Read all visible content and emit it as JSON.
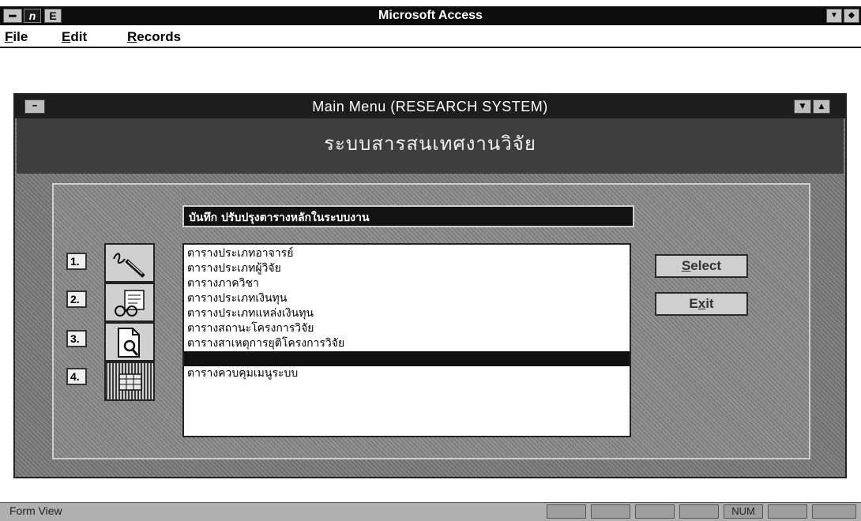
{
  "app": {
    "title": "Microsoft Access",
    "control_menu": "━",
    "icon_n": "n",
    "icon_e": "E",
    "minimize": "▼",
    "restore": "◆"
  },
  "menubar": {
    "items": [
      {
        "key": "F",
        "rest": "ile"
      },
      {
        "key": "E",
        "rest": "dit"
      },
      {
        "key": "R",
        "rest": "ecords"
      }
    ]
  },
  "form": {
    "title": "Main  Menu (RESEARCH SYSTEM)",
    "subtitle": "ระบบสารสนเทศงานวิจัย",
    "control_menu": "━",
    "minimize": "▼",
    "maximize": "▲",
    "list_caption": "บันทึก ปรับปรุงตารางหลักในระบบงาน",
    "numbers": [
      "1.",
      "2.",
      "3.",
      "4."
    ],
    "icons": [
      "pen-signature-icon",
      "glasses-document-icon",
      "magnifier-document-icon",
      "table-icon"
    ],
    "list_items": [
      "ตารางประเภทอาจารย์",
      "ตารางประเภทผู้วิจัย",
      "ตารางภาควิชา",
      "ตารางประเภทเงินทุน",
      "ตารางประเภทแหล่งเงินทุน",
      "ตารางสถานะโครงการวิจัย",
      "ตารางสาเหตุการยุติโครงการวิจัย",
      "",
      "ตารางควบคุมเมนูระบบ"
    ],
    "selected_index": 7,
    "select_button": {
      "key": "S",
      "rest": "elect"
    },
    "exit_button": {
      "pre": "E",
      "key": "x",
      "rest": "it"
    }
  },
  "status": {
    "text": "Form View",
    "num": "NUM"
  }
}
